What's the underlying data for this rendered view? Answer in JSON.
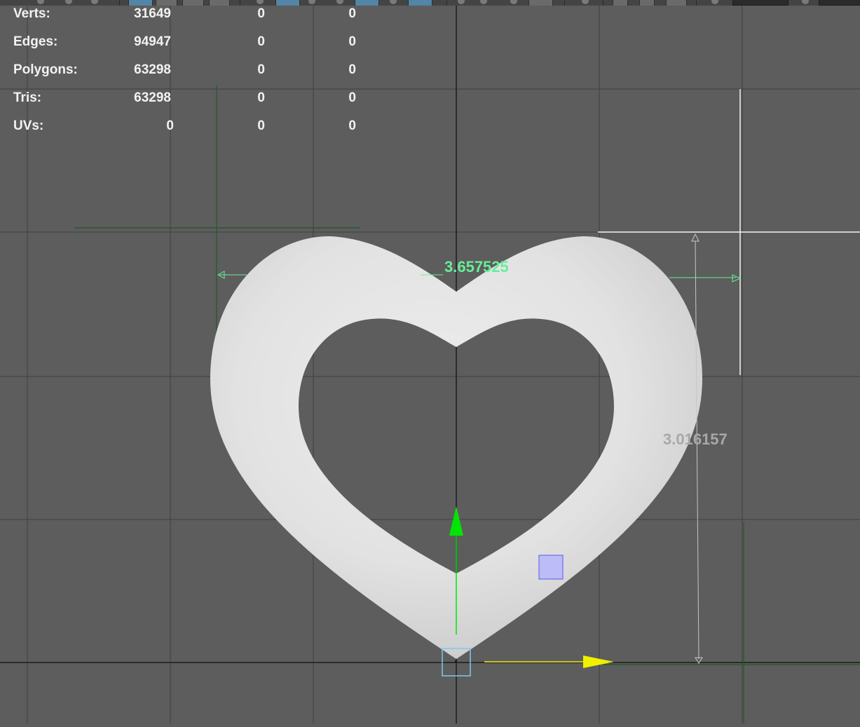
{
  "viewport": {
    "background_color": "#5d5d5d",
    "grid_color": "#404040",
    "axis_color": "#2b2b2b"
  },
  "heads_up_display": {
    "rows": [
      {
        "label": "Verts:",
        "values": [
          "31649",
          "0",
          "0"
        ]
      },
      {
        "label": "Edges:",
        "values": [
          "94947",
          "0",
          "0"
        ]
      },
      {
        "label": "Polygons:",
        "values": [
          "63298",
          "0",
          "0"
        ]
      },
      {
        "label": "Tris:",
        "values": [
          "63298",
          "0",
          "0"
        ]
      },
      {
        "label": "UVs:",
        "values": [
          "0",
          "0",
          "0"
        ]
      }
    ]
  },
  "measurements": {
    "width_value": "3.657525",
    "width_color": "#66ee99",
    "height_value": "3.016157",
    "height_color": "#a8a8a8"
  },
  "model": {
    "shape": "heart-ring",
    "surface_color": "#e3e3e3"
  },
  "manipulator": {
    "y_axis_color": "#00e600",
    "x_axis_color": "#f0f000",
    "pivot_color": "#7fc8f0",
    "plane_handle_color": "#b4b4ff"
  }
}
